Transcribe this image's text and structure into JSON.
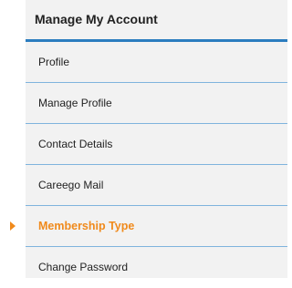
{
  "panel": {
    "title": "Manage My Account",
    "accent_color": "#2b7dbf",
    "active_color": "#f08a1c",
    "items": [
      {
        "label": "Profile",
        "active": false
      },
      {
        "label": "Manage Profile",
        "active": false
      },
      {
        "label": "Contact Details",
        "active": false
      },
      {
        "label": "Careego Mail",
        "active": false
      },
      {
        "label": "Membership Type",
        "active": true,
        "icon": "caret-right-icon"
      },
      {
        "label": "Change Password",
        "active": false
      }
    ]
  }
}
